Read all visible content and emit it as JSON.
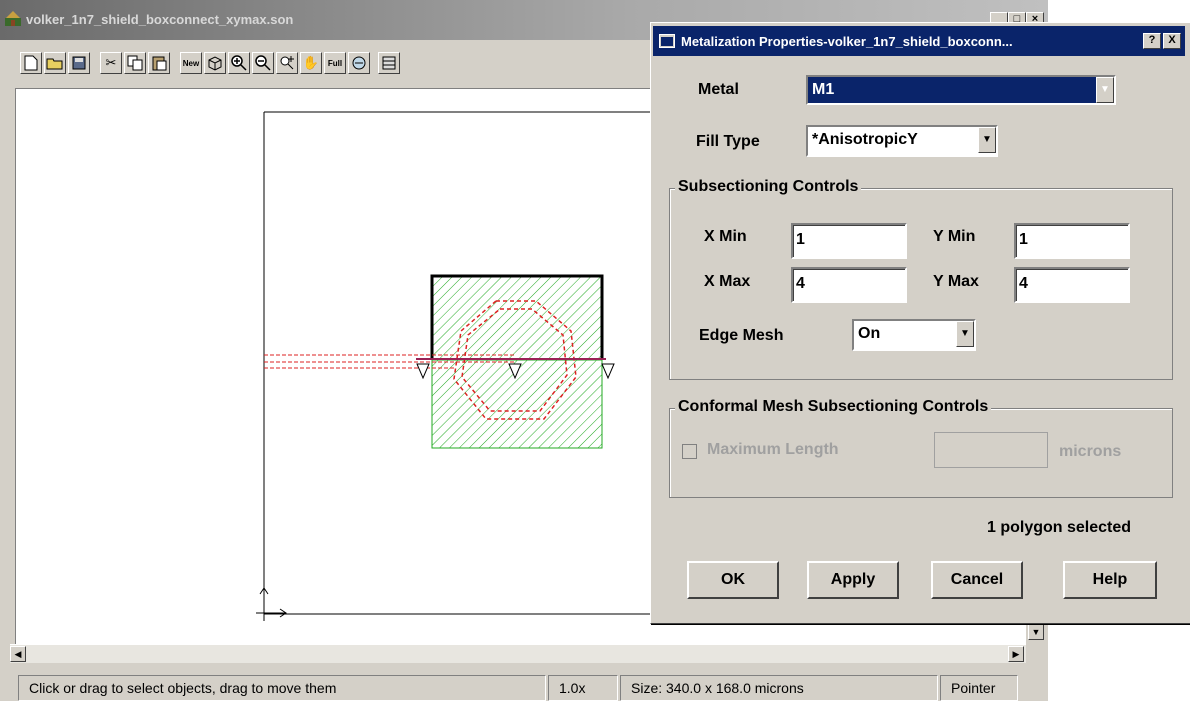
{
  "main_window": {
    "title": "volker_1n7_shield_boxconnect_xymax.son",
    "toolbar": {
      "new_label": "New",
      "full_label": "Full"
    }
  },
  "statusbar": {
    "message": "Click or drag to select objects, drag to move them",
    "zoom": "1.0x",
    "size": "Size: 340.0 x 168.0 microns",
    "mode": "Pointer"
  },
  "dialog": {
    "title": "Metalization Properties-volker_1n7_shield_boxconn...",
    "help_glyph": "?",
    "close_glyph": "X",
    "metal_label": "Metal",
    "metal_value": "M1",
    "fill_type_label": "Fill Type",
    "fill_type_value": "*AnisotropicY",
    "subsectioning": {
      "legend": "Subsectioning Controls",
      "xmin_label": "X Min",
      "xmin_value": "1",
      "ymin_label": "Y Min",
      "ymin_value": "1",
      "xmax_label": "X Max",
      "xmax_value": "4",
      "ymax_label": "Y Max",
      "ymax_value": "4",
      "edge_mesh_label": "Edge Mesh",
      "edge_mesh_value": "On"
    },
    "conformal": {
      "legend": "Conformal Mesh Subsectioning Controls",
      "max_length_label": "Maximum Length",
      "max_length_value": "",
      "units": "microns"
    },
    "selection_status": "1 polygon selected",
    "buttons": {
      "ok": "OK",
      "apply": "Apply",
      "cancel": "Cancel",
      "help": "Help"
    }
  }
}
